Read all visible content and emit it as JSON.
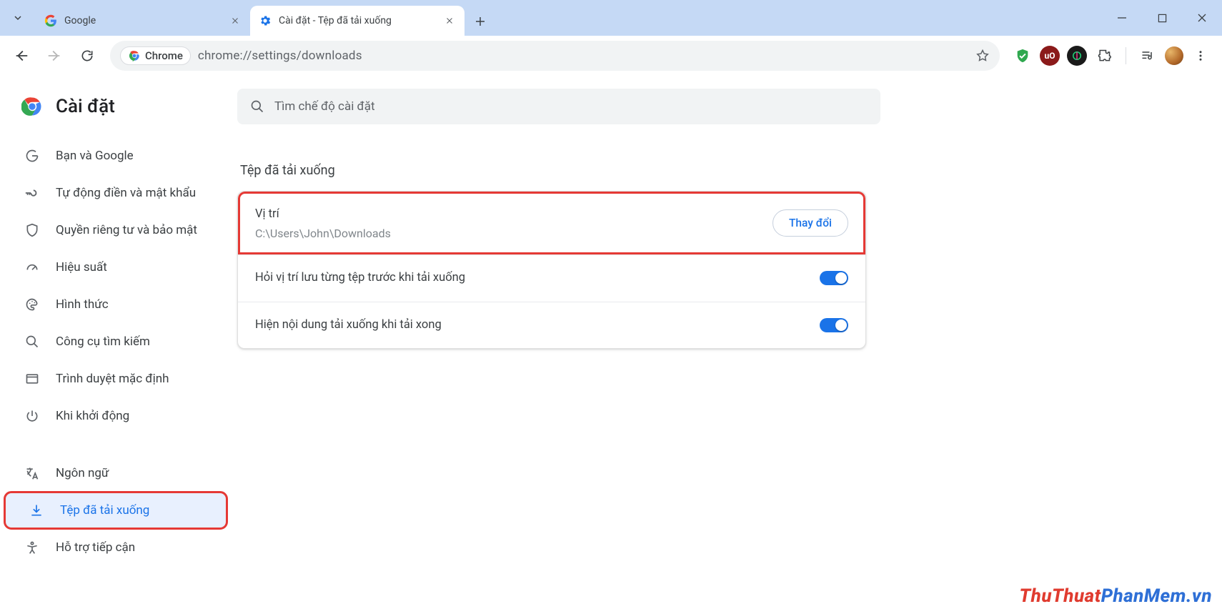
{
  "window": {
    "tabs": [
      {
        "title": "Google",
        "active": false
      },
      {
        "title": "Cài đặt - Tệp đã tải xuống",
        "active": true
      }
    ]
  },
  "toolbar": {
    "chip_label": "Chrome",
    "url": "chrome://settings/downloads"
  },
  "sidebar": {
    "title": "Cài đặt",
    "items": [
      {
        "label": "Bạn và Google"
      },
      {
        "label": "Tự động điền và mật khẩu"
      },
      {
        "label": "Quyền riêng tư và bảo mật"
      },
      {
        "label": "Hiệu suất"
      },
      {
        "label": "Hình thức"
      },
      {
        "label": "Công cụ tìm kiếm"
      },
      {
        "label": "Trình duyệt mặc định"
      },
      {
        "label": "Khi khởi động"
      },
      {
        "label": "Ngôn ngữ"
      },
      {
        "label": "Tệp đã tải xuống"
      },
      {
        "label": "Hỗ trợ tiếp cận"
      }
    ]
  },
  "search": {
    "placeholder": "Tìm chế độ cài đặt"
  },
  "main": {
    "section_title": "Tệp đã tải xuống",
    "location_label": "Vị trí",
    "location_value": "C:\\Users\\John\\Downloads",
    "change_button": "Thay đổi",
    "ask_label": "Hỏi vị trí lưu từng tệp trước khi tải xuống",
    "show_label": "Hiện nội dung tải xuống khi tải xong"
  },
  "watermark": {
    "part1": "ThuThuat",
    "part2": "PhanMem",
    "part3": ".vn"
  }
}
